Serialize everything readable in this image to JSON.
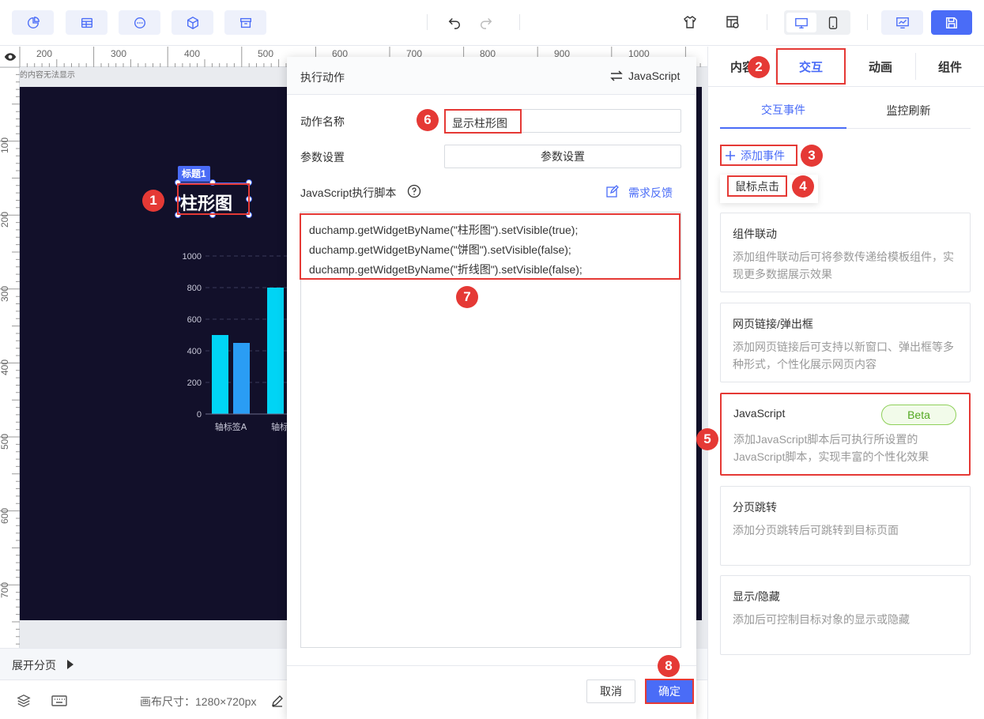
{
  "toolbar": {
    "left_buttons": [
      "chart-pie-icon",
      "table-icon",
      "more-circle-icon",
      "cube-icon",
      "archive-icon"
    ],
    "undo_icon": "undo-icon",
    "redo_icon": "redo-icon"
  },
  "ruler": {
    "top_ticks": [
      "200",
      "300",
      "400",
      "500",
      "600",
      "700",
      "800",
      "900",
      "1000"
    ],
    "left_ticks": [
      "100",
      "200",
      "300",
      "400",
      "500",
      "600",
      "700"
    ]
  },
  "canvas": {
    "hint": "的内容无法显示",
    "title_tag": "标题1",
    "title_text": "柱形图"
  },
  "chart_data": {
    "type": "bar",
    "categories": [
      "轴标签A",
      "轴标"
    ],
    "series": [
      {
        "values": [
          500,
          800
        ]
      },
      {
        "values": [
          450,
          null
        ]
      }
    ],
    "ylim": [
      0,
      1000
    ],
    "yticks": [
      "0",
      "200",
      "400",
      "600",
      "800",
      "1000"
    ],
    "colors": [
      "#00d4f5",
      "#2a9df4"
    ]
  },
  "dialog": {
    "title": "执行动作",
    "mode_label": "JavaScript",
    "action_name_label": "动作名称",
    "action_name_value": "显示柱形图",
    "param_label": "参数设置",
    "param_button": "参数设置",
    "script_label": "JavaScript执行脚本",
    "feedback_link": "需求反馈",
    "code_lines": [
      "duchamp.getWidgetByName(\"柱形图\").setVisible(true);",
      "duchamp.getWidgetByName(\"饼图\").setVisible(false);",
      "duchamp.getWidgetByName(\"折线图\").setVisible(false);"
    ],
    "cancel": "取消",
    "confirm": "确定"
  },
  "bottom": {
    "expand_label": "展开分页",
    "canvas_size": "画布尺寸：1280×720px"
  },
  "right_panel": {
    "tabs": [
      "内容",
      "交互",
      "动画",
      "组件"
    ],
    "subtabs": [
      "交互事件",
      "监控刷新"
    ],
    "add_event": "添加事件",
    "mouse_click": "鼠标点击",
    "cards": [
      {
        "title": "组件联动",
        "desc": "添加组件联动后可将参数传递给模板组件，实现更多数据展示效果"
      },
      {
        "title": "网页链接/弹出框",
        "desc": "添加网页链接后可支持以新窗口、弹出框等多种形式，个性化展示网页内容"
      },
      {
        "title": "JavaScript",
        "badge": "Beta",
        "desc": "添加JavaScript脚本后可执行所设置的JavaScript脚本，实现丰富的个性化效果"
      },
      {
        "title": "分页跳转",
        "desc": "添加分页跳转后可跳转到目标页面"
      },
      {
        "title": "显示/隐藏",
        "desc": "添加后可控制目标对象的显示或隐藏"
      }
    ]
  },
  "badges": [
    "1",
    "2",
    "3",
    "4",
    "5",
    "6",
    "7",
    "8"
  ],
  "colors": {
    "accent": "#4a6cf7",
    "annotation_red": "#e53935",
    "canvas_dark": "#12102a"
  }
}
